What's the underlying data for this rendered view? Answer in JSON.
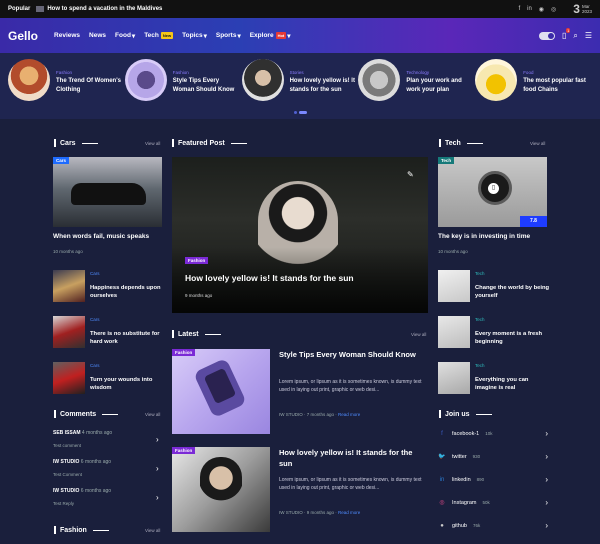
{
  "topbar": {
    "popular_label": "Popular",
    "headline": "How to spend a vacation in the Maldives",
    "social_icons": [
      "facebook",
      "linkedin",
      "github",
      "instagram"
    ],
    "date_day": "3",
    "date_month": "Mar",
    "date_year": "2023"
  },
  "nav": {
    "logo": "Gello",
    "items": [
      {
        "label": "Reviews"
      },
      {
        "label": "News"
      },
      {
        "label": "Food",
        "arrow": "▾"
      },
      {
        "label": "Tech",
        "badge": "New"
      },
      {
        "label": "Topics",
        "arrow": "▾"
      },
      {
        "label": "Sports",
        "arrow": "▾"
      },
      {
        "label": "Explore",
        "badge": "Hot",
        "arrow": "▾"
      }
    ],
    "bookmark_count": "1"
  },
  "carousel": [
    {
      "category": "Fashion",
      "title": "The Trend Of Women's Clothing"
    },
    {
      "category": "Fashion",
      "title": "Style Tips Every Woman Should Know"
    },
    {
      "category": "Stories",
      "title": "How lovely yellow is! It stands for the sun"
    },
    {
      "category": "Technology",
      "title": "Plan your work and work your plan"
    },
    {
      "category": "Food",
      "title": "The most popular fast food Chains"
    }
  ],
  "sections": {
    "cars": "Cars",
    "featured": "Featured Post",
    "tech": "Tech",
    "latest": "Latest",
    "comments": "Comments",
    "join": "Join us",
    "fashion": "Fashion",
    "view_all": "View all"
  },
  "cars": {
    "tag": "Cars",
    "main_title": "When words fail, music speaks",
    "main_time": "10 months ago",
    "items": [
      {
        "category": "Cars",
        "title": "Happiness depends upon ourselves"
      },
      {
        "category": "Cars",
        "title": "There is no substitute for hard work"
      },
      {
        "category": "Cars",
        "title": "Turn your wounds into wisdom"
      }
    ]
  },
  "featured": {
    "tag": "Fashion",
    "title": "How lovely yellow is! It stands for the sun",
    "time": "9 months ago"
  },
  "tech": {
    "tag": "Tech",
    "rating": "7.8",
    "main_title": "The key is in investing in time",
    "main_time": "10 months ago",
    "items": [
      {
        "category": "Tech",
        "title": "Change the world by being yourself"
      },
      {
        "category": "Tech",
        "title": "Every moment is a fresh beginning"
      },
      {
        "category": "Tech",
        "title": "Everything you can imagine is real"
      }
    ]
  },
  "latest": [
    {
      "tag": "Fashion",
      "title": "Style Tips Every Woman Should Know",
      "excerpt": "Lorem ipsum, or lipsum as it is sometimes known, is dummy text used in laying out print, graphic or web desi...",
      "author": "IW STUDIO",
      "time": "7 months ago",
      "read_more": "Read more"
    },
    {
      "tag": "Fashion",
      "title": "How lovely yellow is! It stands for the sun",
      "excerpt": "Lorem ipsum, or lipsum as it is sometimes known, is dummy text used in laying out print, graphic or web desi...",
      "author": "IW STUDIO",
      "time": "9 months ago",
      "read_more": "Read more"
    }
  ],
  "comments": [
    {
      "author": "SEB ISSAM",
      "time": "4 months ago",
      "text": "Test comment"
    },
    {
      "author": "IW STUDIO",
      "time": "6 months ago",
      "text": "Test Comment"
    },
    {
      "author": "IW STUDIO",
      "time": "6 months ago",
      "text": "Test Reply"
    }
  ],
  "join": [
    {
      "icon": "facebook-icon",
      "glyph": "f",
      "name": "facebook-1",
      "count": "10k",
      "color": "#3b5cc4"
    },
    {
      "icon": "twitter-icon",
      "glyph": "🐦",
      "name": "twitter",
      "count": "930",
      "color": "#1da1f2"
    },
    {
      "icon": "linkedin-icon",
      "glyph": "in",
      "name": "linkedin",
      "count": "890",
      "color": "#2a7bd0"
    },
    {
      "icon": "instagram-icon",
      "glyph": "◎",
      "name": "Instagram",
      "count": "50k",
      "color": "#e84a8a"
    },
    {
      "icon": "github-icon",
      "glyph": "●",
      "name": "github",
      "count": "76k",
      "color": "#cccccc"
    }
  ]
}
